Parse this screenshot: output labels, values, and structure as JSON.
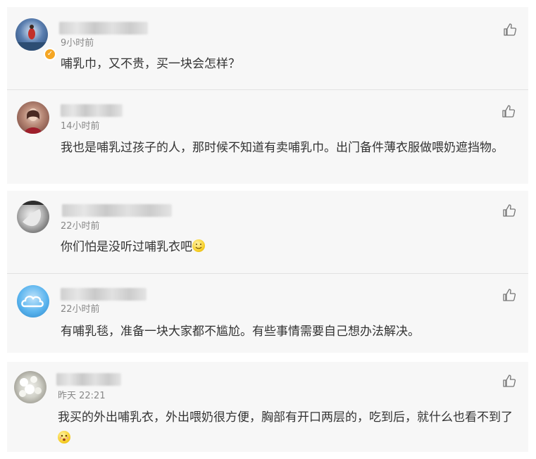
{
  "comments": [
    {
      "time": "9小时前",
      "text": "哺乳巾，又不贵，买一块会怎样？"
    },
    {
      "time": "14小时前",
      "text": "我也是哺乳过孩子的人，那时候不知道有卖哺乳巾。出门备件薄衣服做喂奶遮挡物。"
    },
    {
      "time": "22小时前",
      "text": "你们怕是没听过哺乳衣吧"
    },
    {
      "time": "22小时前",
      "text": "有哺乳毯，准备一块大家都不尴尬。有些事情需要自己想办法解决。"
    },
    {
      "time": "昨天 22:21",
      "text": "我买的外出哺乳衣，外出喂奶很方便，胸部有开口两层的，吃到后，就什么也看不到了"
    }
  ],
  "icons": {
    "like": "thumbs-up-icon",
    "verified": "verified-badge-icon",
    "smile_emoji": "smile-emoji",
    "surprised_emoji": "surprised-emoji"
  },
  "colors": {
    "card_bg": "#f7f7f7",
    "time": "#888888",
    "text": "#333333",
    "verified": "#f5a623"
  }
}
